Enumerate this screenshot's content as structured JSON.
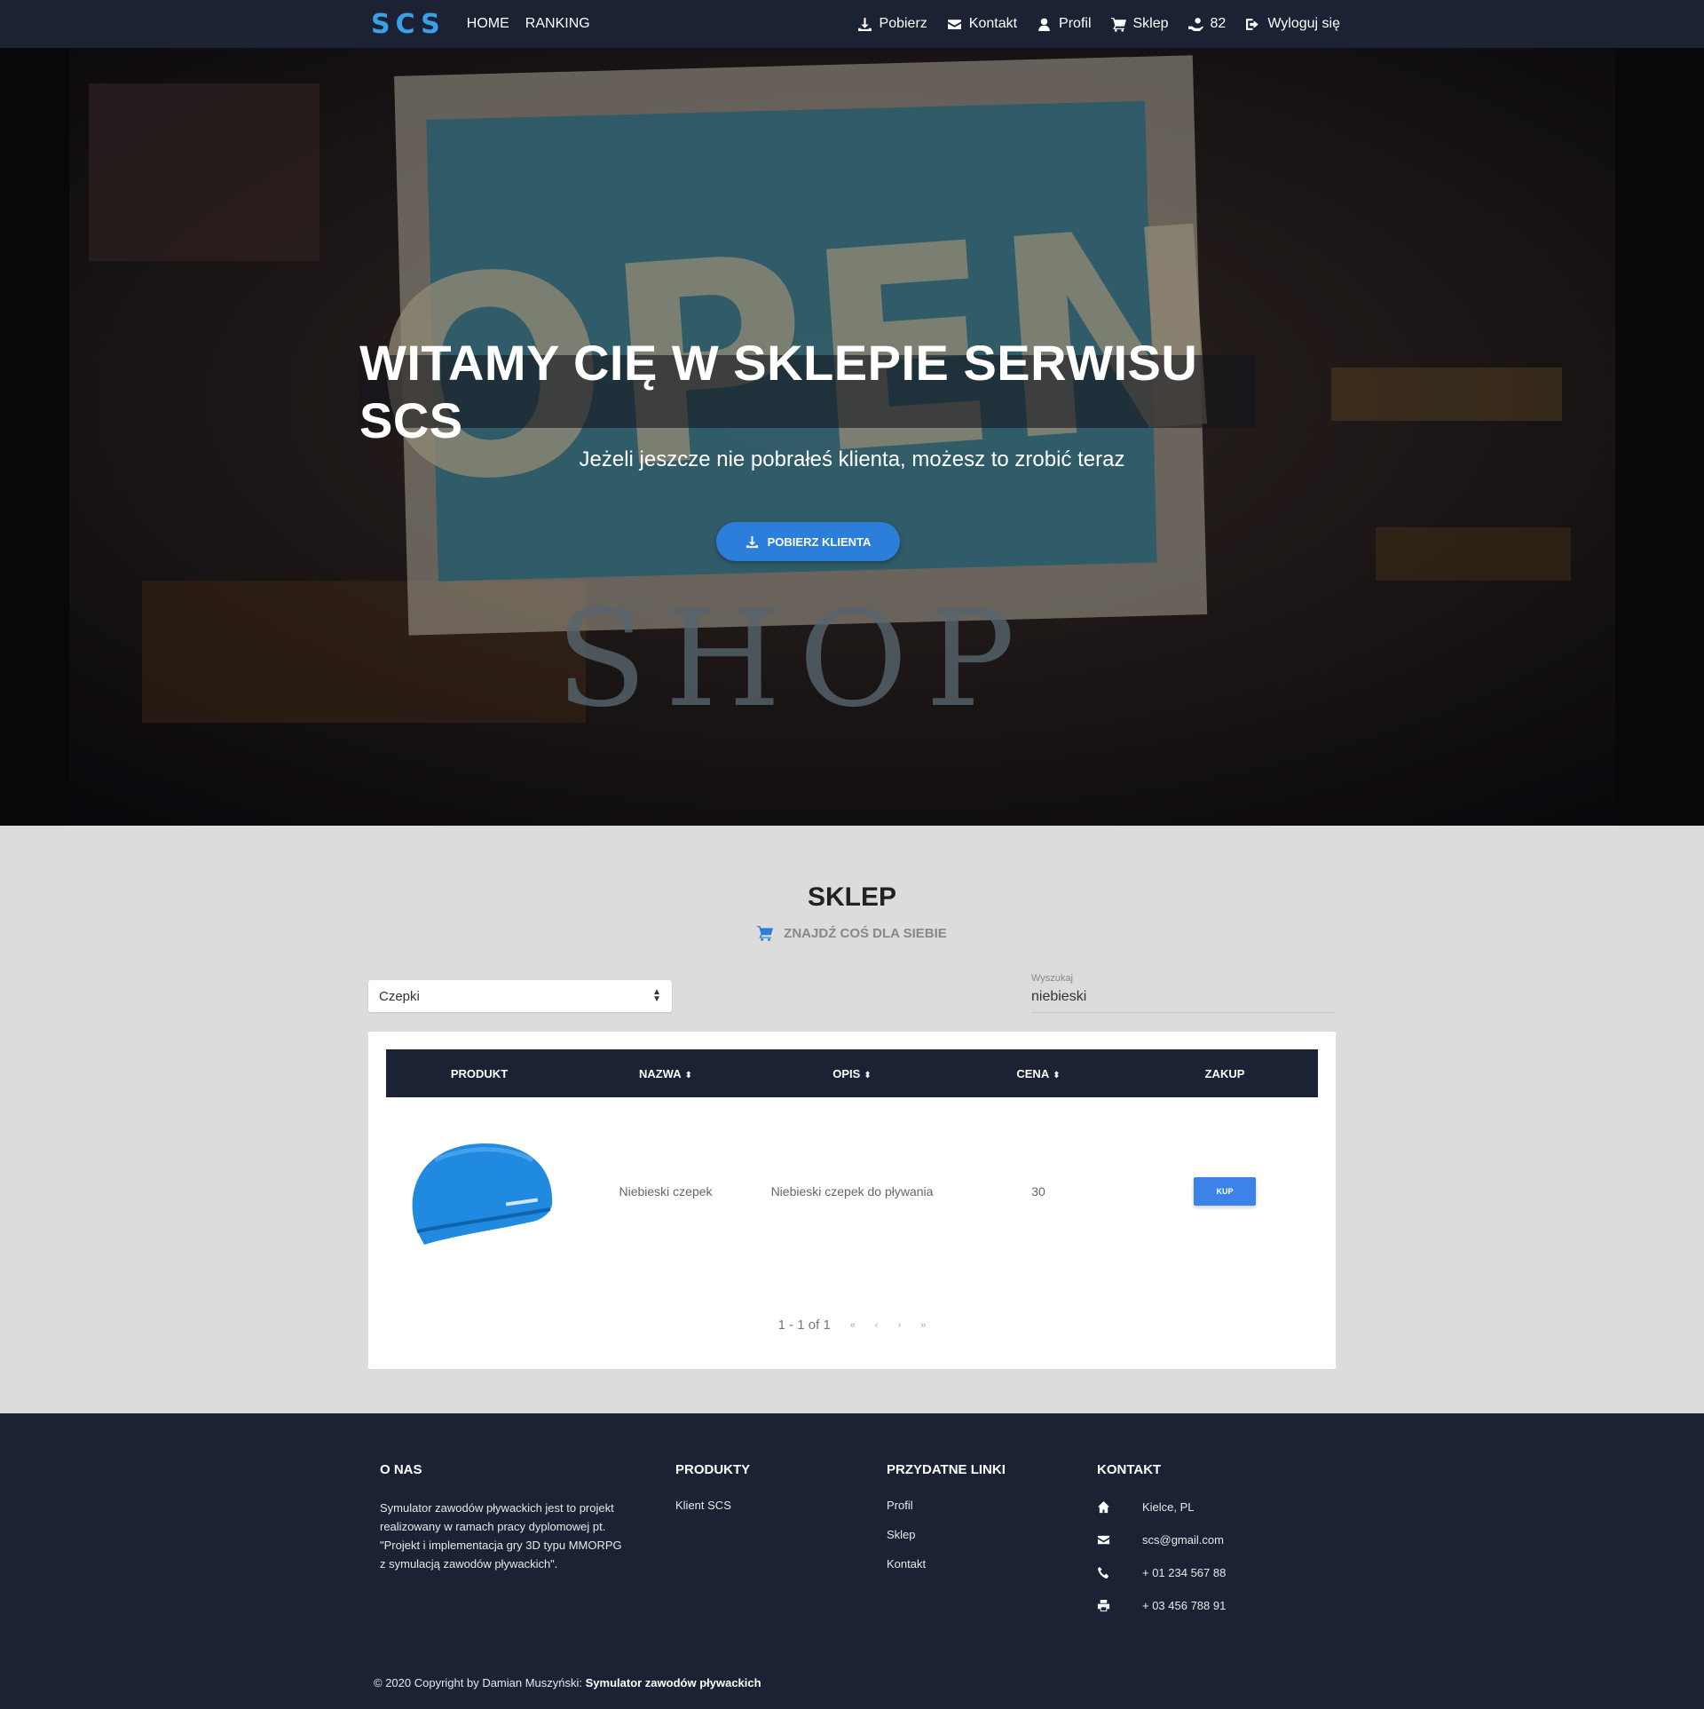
{
  "nav": {
    "logo": "SCS",
    "left": [
      "HOME",
      "RANKING"
    ],
    "right": [
      {
        "icon": "download-icon",
        "label": "Pobierz"
      },
      {
        "icon": "envelope-icon",
        "label": "Kontakt"
      },
      {
        "icon": "user-icon",
        "label": "Profil"
      },
      {
        "icon": "cart-icon",
        "label": "Sklep"
      },
      {
        "icon": "coins-icon",
        "label": "82"
      },
      {
        "icon": "logout-icon",
        "label": "Wyloguj się"
      }
    ]
  },
  "hero": {
    "title": "WITAMY CIĘ W SKLEPIE SERWISU SCS",
    "subtitle": "Jeżeli jeszcze nie pobrałeś klienta, możesz to zrobić teraz",
    "button": "POBIERZ KLIENTA",
    "sign_open": "OPEN",
    "sign_shop": "SHOP"
  },
  "shop": {
    "title": "SKLEP",
    "subtitle": "ZNAJDŹ COŚ DLA SIEBIE",
    "category": "Czepki",
    "search_label": "Wyszukaj",
    "search_value": "niebieski",
    "columns": [
      "PRODUKT",
      "NAZWA",
      "OPIS",
      "CENA",
      "ZAKUP"
    ],
    "rows": [
      {
        "name": "Niebieski czepek",
        "desc": "Niebieski czepek do pływania",
        "price": "30",
        "buy": "KUP"
      }
    ],
    "pagination": "1 - 1 of 1",
    "pager_symbols": [
      "«",
      "‹",
      "›",
      "»"
    ]
  },
  "footer": {
    "about_title": "O NAS",
    "about_text": "Symulator zawodów pływackich jest to projekt realizowany w ramach pracy dyplomowej pt. \"Projekt i implementacja gry 3D typu MMORPG z symulacją zawodów pływackich\".",
    "products_title": "PRODUKTY",
    "products": [
      "Klient SCS"
    ],
    "links_title": "PRZYDATNE LINKI",
    "links": [
      "Profil",
      "Sklep",
      "Kontakt"
    ],
    "contact_title": "KONTAKT",
    "contact": [
      {
        "icon": "home-icon",
        "text": "Kielce, PL"
      },
      {
        "icon": "envelope-icon",
        "text": "scs@gmail.com"
      },
      {
        "icon": "phone-icon",
        "text": "+ 01 234 567 88"
      },
      {
        "icon": "print-icon",
        "text": "+ 03 456 788 91"
      }
    ],
    "copyright_prefix": "© 2020 Copyright by Damian Muszyński: ",
    "copyright_bold": "Symulator zawodów pływackich"
  },
  "colors": {
    "navy": "#1b2233",
    "accent": "#2b7fdb",
    "logo": "#3aa0e8"
  }
}
